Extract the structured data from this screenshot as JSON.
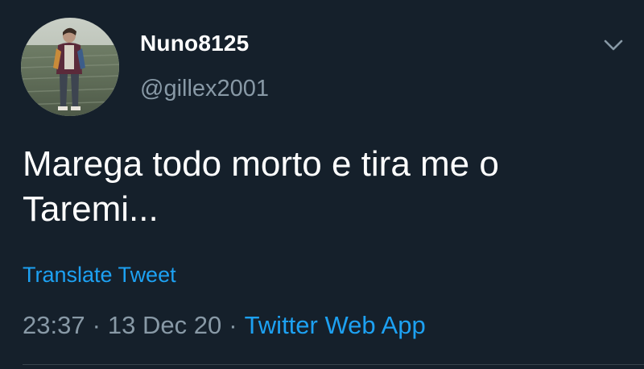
{
  "tweet": {
    "author": {
      "display_name": "Nuno8125",
      "handle": "@gillex2001"
    },
    "text": "Marega todo morto e tira me o Taremi...",
    "translate_label": "Translate Tweet",
    "time": "23:37",
    "date": "13 Dec 20",
    "separator": "·",
    "source": "Twitter Web App"
  },
  "colors": {
    "background": "#15202b",
    "primary_text": "#ffffff",
    "secondary_text": "#8899a6",
    "accent": "#1da1f2"
  },
  "icons": {
    "menu": "chevron-down-icon"
  }
}
